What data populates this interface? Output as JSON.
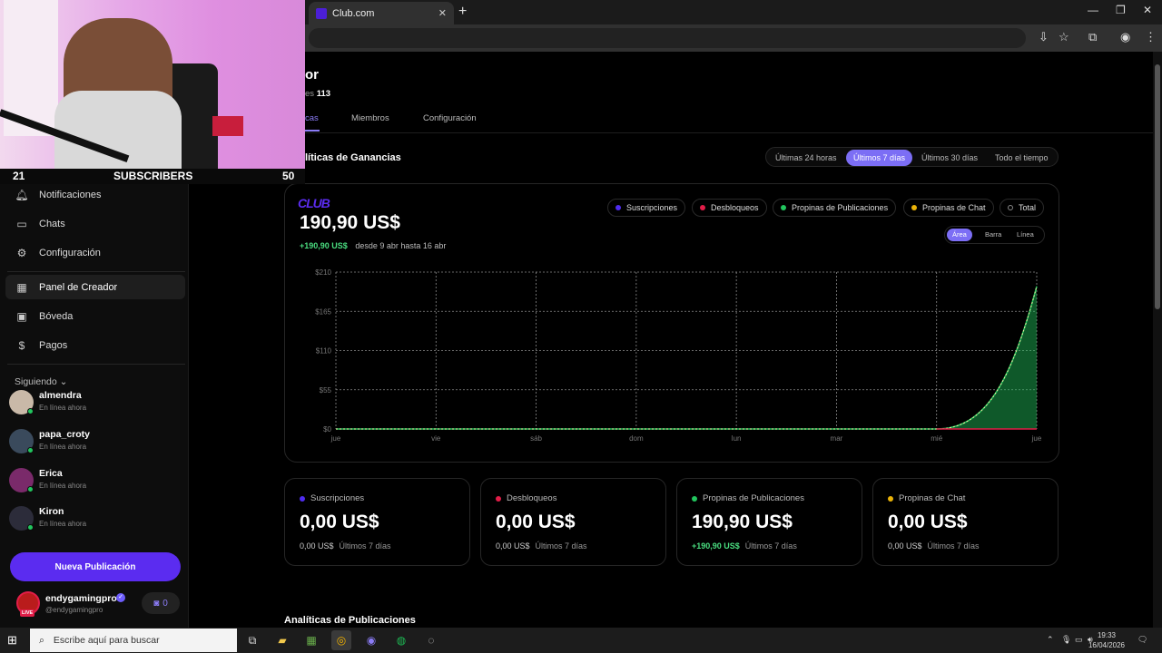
{
  "browser": {
    "tab_title": "Club.com"
  },
  "webcam": {
    "left_count": "21",
    "label": "SUBSCRIBERS",
    "right_count": "50"
  },
  "sidebar": {
    "items": [
      {
        "label": "Notificaciones",
        "icon": "bell-icon"
      },
      {
        "label": "Chats",
        "icon": "chat-icon"
      },
      {
        "label": "Configuración",
        "icon": "gear-icon"
      },
      {
        "label": "Panel de Creador",
        "icon": "dashboard-icon"
      },
      {
        "label": "Bóveda",
        "icon": "vault-icon"
      },
      {
        "label": "Pagos",
        "icon": "dollar-icon"
      }
    ],
    "following_label": "Siguiendo",
    "following": [
      {
        "name": "almendra",
        "status": "En línea ahora"
      },
      {
        "name": "papa_croty",
        "status": "En línea ahora"
      },
      {
        "name": "Erica",
        "status": "En línea ahora"
      },
      {
        "name": "Kiron",
        "status": "En línea ahora"
      }
    ],
    "new_post_label": "Nueva Publicación",
    "profile": {
      "name": "endygamingpro",
      "handle": "@endygamingpro",
      "live": "LIVE",
      "badge_count": "0"
    }
  },
  "header": {
    "title": "or",
    "subtitle_prefix": "es",
    "subtitle_value": "113",
    "tabs": [
      "cas",
      "Miembros",
      "Configuración"
    ]
  },
  "earnings": {
    "section_title": "líticas de Ganancias",
    "ranges": [
      "Últimas 24 horas",
      "Últimos 7 días",
      "Últimos 30 días",
      "Todo el tiempo"
    ],
    "logo_text": "CLUB",
    "total": "190,90 US$",
    "delta": "+190,90 US$",
    "period": "desde 9 abr hasta 16 abr",
    "legend": [
      {
        "label": "Suscripciones",
        "color": "#4f2cf0"
      },
      {
        "label": "Desbloqueos",
        "color": "#e11d48"
      },
      {
        "label": "Propinas de Publicaciones",
        "color": "#22c55e"
      },
      {
        "label": "Propinas de Chat",
        "color": "#eab308"
      },
      {
        "label": "Total",
        "color": "#000000"
      }
    ],
    "chart_types": [
      "Área",
      "Barra",
      "Línea"
    ]
  },
  "chart_data": {
    "type": "area",
    "categories": [
      "jue",
      "vie",
      "sáb",
      "dom",
      "lun",
      "mar",
      "mié",
      "jue"
    ],
    "ylim": [
      0,
      210
    ],
    "yticks": [
      "$0",
      "$55",
      "$110",
      "$165",
      "$210"
    ],
    "grid": true,
    "series": [
      {
        "name": "Propinas de Publicaciones",
        "color": "#22c55e",
        "values": [
          0,
          0,
          0,
          0,
          0,
          0,
          0,
          190.9
        ]
      }
    ]
  },
  "stats": [
    {
      "label": "Suscripciones",
      "color": "#4f2cf0",
      "value": "0,00 US$",
      "sub_value": "0,00 US$",
      "sub_label": "Últimos 7 días",
      "positive": false
    },
    {
      "label": "Desbloqueos",
      "color": "#e11d48",
      "value": "0,00 US$",
      "sub_value": "0,00 US$",
      "sub_label": "Últimos 7 días",
      "positive": false
    },
    {
      "label": "Propinas de Publicaciones",
      "color": "#22c55e",
      "value": "190,90 US$",
      "sub_value": "+190,90 US$",
      "sub_label": "Últimos 7 días",
      "positive": true
    },
    {
      "label": "Propinas de Chat",
      "color": "#eab308",
      "value": "0,00 US$",
      "sub_value": "0,00 US$",
      "sub_label": "Últimos 7 días",
      "positive": false
    }
  ],
  "posts_section_title": "Analíticas de Publicaciones",
  "taskbar": {
    "search_placeholder": "Escribe aquí para buscar",
    "time": "19:33",
    "date": "16/04/2026"
  }
}
